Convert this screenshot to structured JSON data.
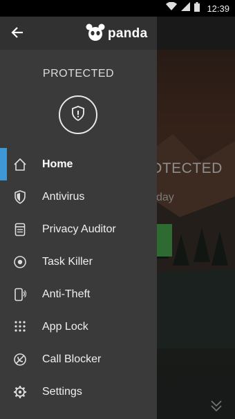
{
  "status_bar": {
    "time": "12:39"
  },
  "background": {
    "status_text": "OTECTED",
    "sub_text": "day",
    "accent_green": "#2e6b33"
  },
  "drawer": {
    "logo_text": "panda",
    "status_label": "PROTECTED",
    "active_color": "#3fa9f5",
    "items": [
      {
        "label": "Home",
        "icon": "home-icon"
      },
      {
        "label": "Antivirus",
        "icon": "shield-icon"
      },
      {
        "label": "Privacy Auditor",
        "icon": "privacy-icon"
      },
      {
        "label": "Task Killer",
        "icon": "task-killer-icon"
      },
      {
        "label": "Anti-Theft",
        "icon": "anti-theft-icon"
      },
      {
        "label": "App Lock",
        "icon": "app-lock-icon"
      },
      {
        "label": "Call Blocker",
        "icon": "call-blocker-icon"
      },
      {
        "label": "Settings",
        "icon": "gear-icon"
      }
    ]
  }
}
